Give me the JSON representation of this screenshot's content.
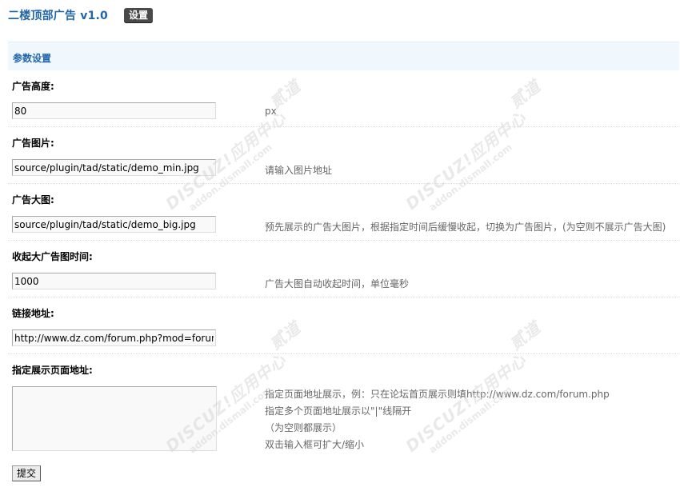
{
  "header": {
    "title": "二楼顶部广告 v1.0",
    "settings_tab": "设置"
  },
  "section": {
    "title": "参数设置"
  },
  "fields": [
    {
      "label": "广告高度:",
      "value": "80",
      "tip": "px"
    },
    {
      "label": "广告图片:",
      "value": "source/plugin/tad/static/demo_min.jpg",
      "tip": "请输入图片地址"
    },
    {
      "label": "广告大图:",
      "value": "source/plugin/tad/static/demo_big.jpg",
      "tip": "预先展示的广告大图片，根据指定时间后缓慢收起，切换为广告图片，(为空则不展示广告大图)"
    },
    {
      "label": "收起大广告图时间:",
      "value": "1000",
      "tip": "广告大图自动收起时间，单位毫秒"
    },
    {
      "label": "链接地址:",
      "value": "http://www.dz.com/forum.php?mod=forum",
      "tip": ""
    },
    {
      "label": "指定展示页面地址:",
      "value": "",
      "tip_lines": [
        "指定页面地址展示，例：只在论坛首页展示则填http://www.dz.com/forum.php",
        "指定多个页面地址展示以\"|\"线隔开",
        "（为空则都展示）",
        "双击输入框可扩大/缩小"
      ]
    }
  ],
  "submit_label": "提交",
  "watermark": {
    "main": "DISCUZ!应用中心",
    "sub": "addon.dismall.com",
    "brand": "贰道"
  },
  "colors": {
    "title_blue": "#2366a8",
    "section_bg": "#f0f7fd",
    "tab_bg": "#4a4a4a",
    "tip_gray": "#666666"
  }
}
